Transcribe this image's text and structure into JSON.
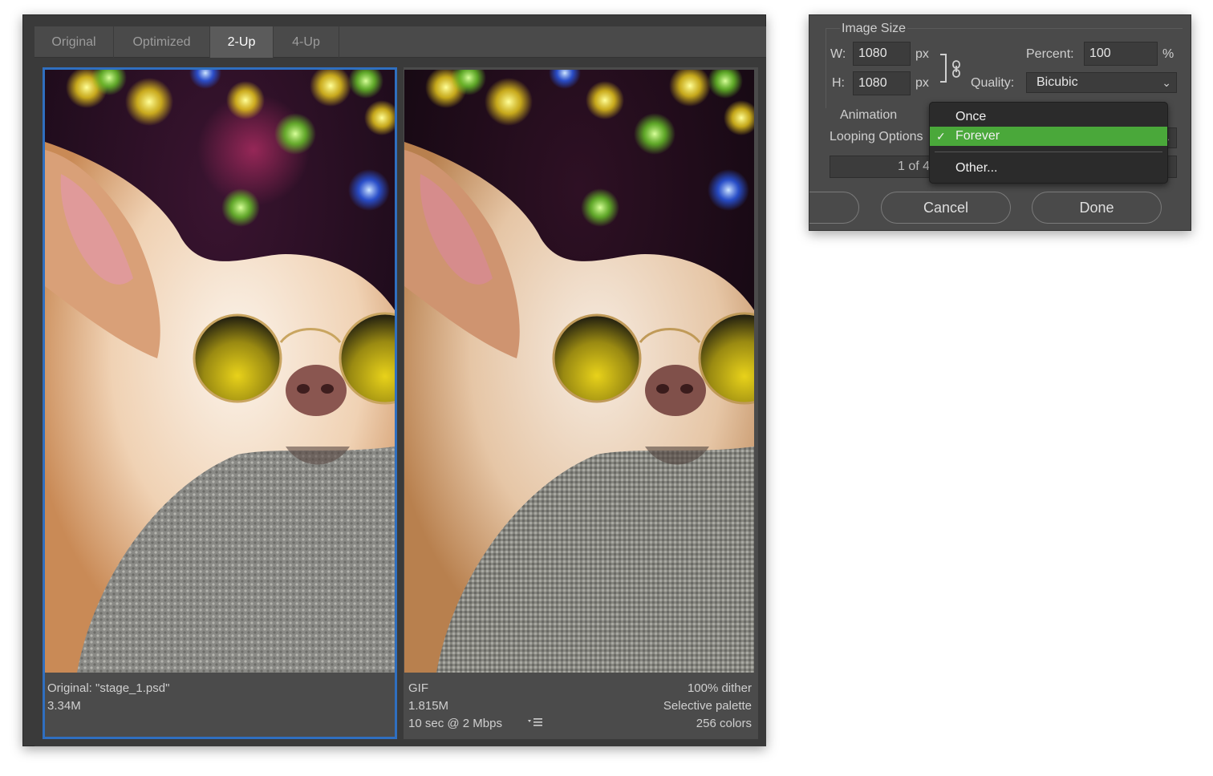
{
  "tabs": [
    {
      "label": "Original",
      "active": false
    },
    {
      "label": "Optimized",
      "active": false
    },
    {
      "label": "2-Up",
      "active": true
    },
    {
      "label": "4-Up",
      "active": false
    }
  ],
  "left_pane": {
    "line1": "Original: \"stage_1.psd\"",
    "line2": "3.34M"
  },
  "right_pane": {
    "format": "GIF",
    "size": "1.815M",
    "download_time": "10 sec @ 2 Mbps",
    "dither": "100% dither",
    "palette": "Selective palette",
    "colors": "256 colors"
  },
  "image_size": {
    "title": "Image Size",
    "w_label": "W:",
    "w_value": "1080",
    "w_unit": "px",
    "h_label": "H:",
    "h_value": "1080",
    "h_unit": "px",
    "percent_label": "Percent:",
    "percent_value": "100",
    "percent_unit": "%",
    "quality_label": "Quality:",
    "quality_value": "Bicubic"
  },
  "animation": {
    "title": "Animation",
    "looping_label": "Looping Options",
    "frame_counter": "1 of 4"
  },
  "looping_menu": {
    "items": [
      "Once",
      "Forever",
      "Other..."
    ],
    "selected": "Forever",
    "check": "✓"
  },
  "buttons": {
    "partial": "..",
    "cancel": "Cancel",
    "done": "Done"
  },
  "colors": {
    "selection_outline": "#2f6fc0",
    "menu_highlight": "#4aa83a"
  }
}
